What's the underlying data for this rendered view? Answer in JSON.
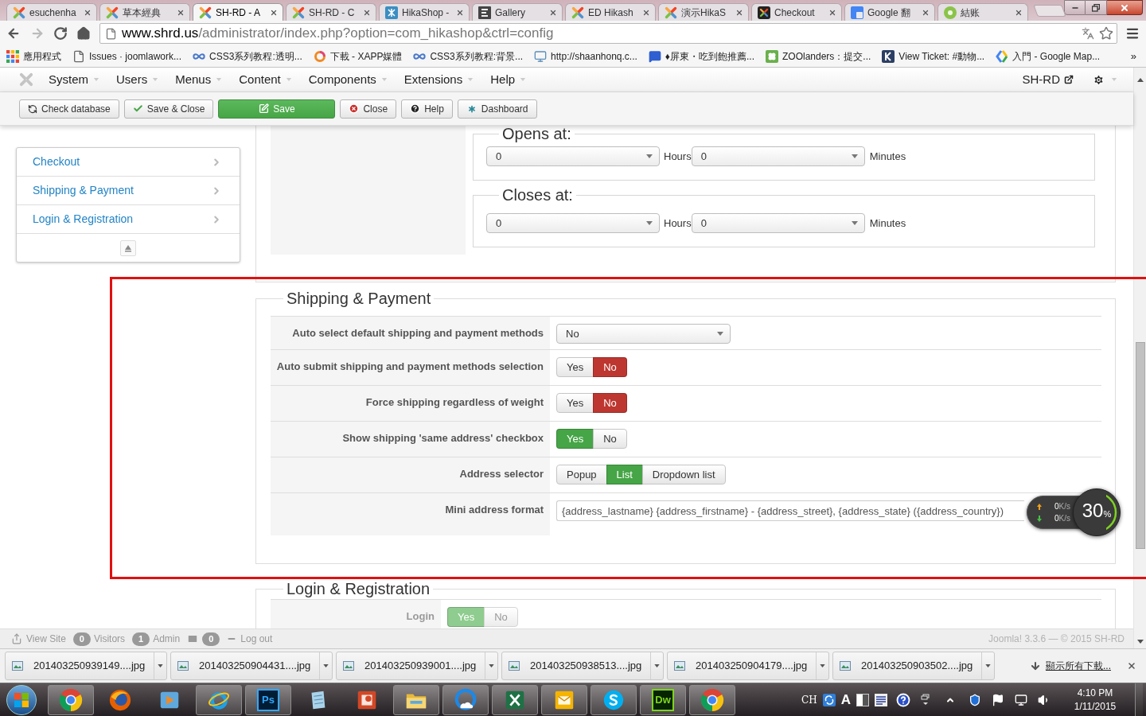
{
  "browser": {
    "tabs": [
      {
        "title": "esuchenha",
        "kind": "joomla",
        "selected": false
      },
      {
        "title": "草本經典",
        "kind": "joomla",
        "selected": false
      },
      {
        "title": "SH-RD - A",
        "kind": "joomla",
        "selected": true
      },
      {
        "title": "SH-RD - C",
        "kind": "joomla",
        "selected": false
      },
      {
        "title": "HikaShop -",
        "kind": "hikashop",
        "selected": false
      },
      {
        "title": "Gallery",
        "kind": "letter",
        "selected": false
      },
      {
        "title": "ED Hikash",
        "kind": "joomla",
        "selected": false
      },
      {
        "title": "演示HikaS",
        "kind": "joomla",
        "selected": false
      },
      {
        "title": "Checkout",
        "kind": "joomla-dark",
        "selected": false
      },
      {
        "title": "Google 翻",
        "kind": "translate",
        "selected": false
      },
      {
        "title": "結账",
        "kind": "circle",
        "selected": false
      }
    ],
    "url": {
      "host": "www.shrd.us",
      "path": "/administrator/index.php?option=com_hikashop&ctrl=config"
    },
    "bookmarks": [
      {
        "label": "應用程式",
        "kind": "apps"
      },
      {
        "label": "Issues · joomlawork...",
        "kind": "page"
      },
      {
        "label": "CSS3系列教程:透明...",
        "kind": "infinity"
      },
      {
        "label": "下載 - XAPP媒體",
        "kind": "ring"
      },
      {
        "label": "CSS3系列教程:背景...",
        "kind": "infinity"
      },
      {
        "label": "http://shaanhonq.c...",
        "kind": "screen"
      },
      {
        "label": "♦屏東・吃到飽推薦...",
        "kind": "bubble"
      },
      {
        "label": "ZOOlanders：提交...",
        "kind": "clover"
      },
      {
        "label": "View Ticket: #動物...",
        "kind": "tile"
      },
      {
        "label": "入門 - Google Map...",
        "kind": "maps"
      }
    ],
    "bookmarks_more": "»"
  },
  "admin_menu": {
    "items": [
      "System",
      "Users",
      "Menus",
      "Content",
      "Components",
      "Extensions",
      "Help"
    ],
    "site_link": "SH-RD"
  },
  "toolbar": [
    {
      "label": "Check database",
      "kind": "check"
    },
    {
      "label": "Save & Close",
      "kind": "save-close"
    },
    {
      "label": "Save",
      "kind": "save"
    },
    {
      "label": "Close",
      "kind": "close"
    },
    {
      "label": "Help",
      "kind": "help"
    },
    {
      "label": "Dashboard",
      "kind": "dashboard"
    }
  ],
  "sidebar": {
    "items": [
      {
        "label": "Checkout",
        "selected": false
      },
      {
        "label": "Shipping & Payment",
        "selected": false
      },
      {
        "label": "Login & Registration",
        "selected": false
      }
    ]
  },
  "hours": [
    {
      "legend": "Opens at:",
      "hours": "0",
      "hours_unit": "Hours",
      "minutes": "0",
      "minutes_unit": "Minutes"
    },
    {
      "legend": "Closes at:",
      "hours": "0",
      "hours_unit": "Hours",
      "minutes": "0",
      "minutes_unit": "Minutes"
    }
  ],
  "shipping_payment": {
    "legend": "Shipping & Payment",
    "rows": [
      {
        "label": "Auto select default shipping and payment methods",
        "kind": "select",
        "value": "No"
      },
      {
        "label": "Auto submit shipping and payment methods selection",
        "kind": "toggle",
        "options": [
          {
            "label": "Yes",
            "selected": false
          },
          {
            "label": "No",
            "selected": true,
            "color": "#bd362f"
          }
        ]
      },
      {
        "label": "Force shipping regardless of weight",
        "kind": "toggle",
        "options": [
          {
            "label": "Yes",
            "selected": false
          },
          {
            "label": "No",
            "selected": true,
            "color": "#bd362f"
          }
        ]
      },
      {
        "label": "Show shipping 'same address' checkbox",
        "kind": "toggle",
        "options": [
          {
            "label": "Yes",
            "selected": true,
            "color": "#46a546"
          },
          {
            "label": "No",
            "selected": false
          }
        ]
      },
      {
        "label": "Address selector",
        "kind": "toggle",
        "options": [
          {
            "label": "Popup",
            "selected": false
          },
          {
            "label": "List",
            "selected": true,
            "color": "#46a546"
          },
          {
            "label": "Dropdown list",
            "selected": false
          }
        ]
      },
      {
        "label": "Mini address format",
        "kind": "text",
        "value": "{address_lastname} {address_firstname} - {address_street}, {address_state} ({address_country})"
      }
    ]
  },
  "login_registration": {
    "legend": "Login & Registration",
    "rows": [
      {
        "label": "Login",
        "kind": "toggle",
        "options": [
          {
            "label": "Yes",
            "selected": true,
            "color": "#8fcc8f"
          },
          {
            "label": "No",
            "selected": false
          }
        ]
      }
    ]
  },
  "annotation": {
    "kind": "rectangle"
  },
  "speed_meter": {
    "rates": [
      {
        "kind": "up",
        "value": "0",
        "unit": "K/s"
      },
      {
        "kind": "down",
        "value": "0",
        "unit": "K/s"
      }
    ],
    "percent": "30",
    "percent_unit": "%",
    "level": 0.3
  },
  "status_bar": {
    "items": [
      {
        "kind": "link",
        "label": "View Site"
      },
      {
        "kind": "count",
        "count": "0",
        "label": "Visitors"
      },
      {
        "kind": "count",
        "count": "1",
        "label": "Admin"
      },
      {
        "kind": "mail",
        "count": "0"
      },
      {
        "kind": "logout",
        "label": "Log out"
      }
    ],
    "copyright": "Joomla! 3.3.6 — © 2015 SH-RD"
  },
  "downloads": {
    "files": [
      "201403250939149....jpg",
      "201403250904431....jpg",
      "201403250939001....jpg",
      "201403250938513....jpg",
      "201403250904179....jpg",
      "201403250903502....jpg"
    ],
    "show_all": "顯示所有下載..."
  },
  "taskbar": {
    "apps": [
      {
        "kind": "chrome",
        "open": true
      },
      {
        "kind": "firefox",
        "open": false
      },
      {
        "kind": "media",
        "open": false
      },
      {
        "kind": "ie",
        "open": true
      },
      {
        "kind": "photoshop",
        "label": "Ps",
        "open": true
      },
      {
        "kind": "notepad",
        "open": false
      },
      {
        "kind": "powerpoint",
        "open": false
      },
      {
        "kind": "explorer",
        "open": true
      },
      {
        "kind": "cloud",
        "open": true
      },
      {
        "kind": "excel",
        "open": true
      },
      {
        "kind": "outlook",
        "open": true
      },
      {
        "kind": "skype",
        "open": true
      },
      {
        "kind": "dreamweaver",
        "label": "Dw",
        "open": true
      },
      {
        "kind": "chrome",
        "open": true
      }
    ],
    "language": "CH",
    "input_mode": "A",
    "time": "4:10 PM",
    "date": "1/11/2015"
  }
}
